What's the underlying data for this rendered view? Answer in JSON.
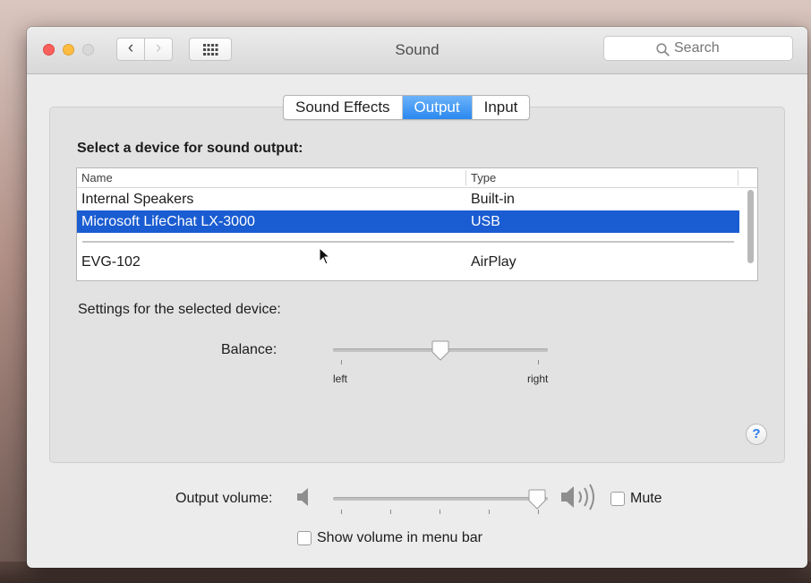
{
  "window": {
    "title": "Sound"
  },
  "toolbar": {
    "back_icon": "chevron-left",
    "forward_icon": "chevron-right",
    "show_all_icon": "grid"
  },
  "search": {
    "placeholder": "Search"
  },
  "tabs": [
    {
      "label": "Sound Effects",
      "selected": false
    },
    {
      "label": "Output",
      "selected": true
    },
    {
      "label": "Input",
      "selected": false
    }
  ],
  "output": {
    "heading": "Select a device for sound output:",
    "columns": {
      "name": "Name",
      "type": "Type"
    },
    "devices": [
      {
        "name": "Internal Speakers",
        "type": "Built-in",
        "selected": false
      },
      {
        "name": "Microsoft LifeChat LX-3000",
        "type": "USB",
        "selected": true
      },
      {
        "name": "EVG-102",
        "type": "AirPlay",
        "selected": false
      }
    ],
    "settings_heading": "Settings for the selected device:",
    "balance": {
      "label": "Balance:",
      "left_label": "left",
      "right_label": "right",
      "value": 0.5
    }
  },
  "help": {
    "label": "?"
  },
  "volume": {
    "label": "Output volume:",
    "value": 0.95,
    "mute_label": "Mute",
    "muted": false
  },
  "menu_bar_option": {
    "label": "Show volume in menu bar",
    "checked": false
  },
  "colors": {
    "accent": "#2a88ef",
    "selection": "#1a5cd1"
  }
}
